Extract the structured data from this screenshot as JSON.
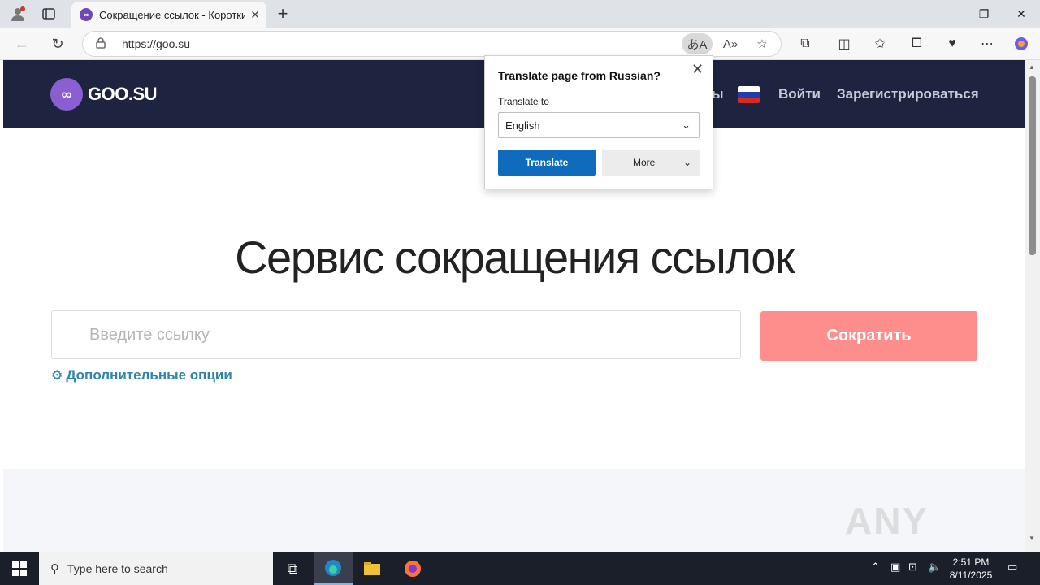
{
  "browser": {
    "tab": {
      "title": "Сокращение ссылок - Короткие",
      "close": "✕"
    },
    "new_tab": "+",
    "window_controls": {
      "minimize": "—",
      "maximize": "❐",
      "close": "✕"
    },
    "toolbar": {
      "url": "https://goo.su"
    }
  },
  "site": {
    "logo_text": "GOO.SU",
    "header_partial": "ы",
    "login": "Войти",
    "register": "Зарегистрироваться",
    "hero_title": "Сервис сокращения ссылок",
    "input_placeholder": "Введите ссылку",
    "shorten_button": "Сократить",
    "options_link": "Дополнительные опции",
    "watermark": "ANY RUN"
  },
  "translate_popup": {
    "title": "Translate page from Russian?",
    "translate_to_label": "Translate to",
    "selected_language": "English",
    "translate_button": "Translate",
    "more_button": "More"
  },
  "taskbar": {
    "search_placeholder": "Type here to search",
    "time": "2:51 PM",
    "date": "8/11/2025"
  },
  "colors": {
    "header_bg": "#1e2440",
    "shorten_button": "#fd8e8c",
    "options_link": "#2e85a8",
    "translate_button": "#0f6cbd"
  }
}
